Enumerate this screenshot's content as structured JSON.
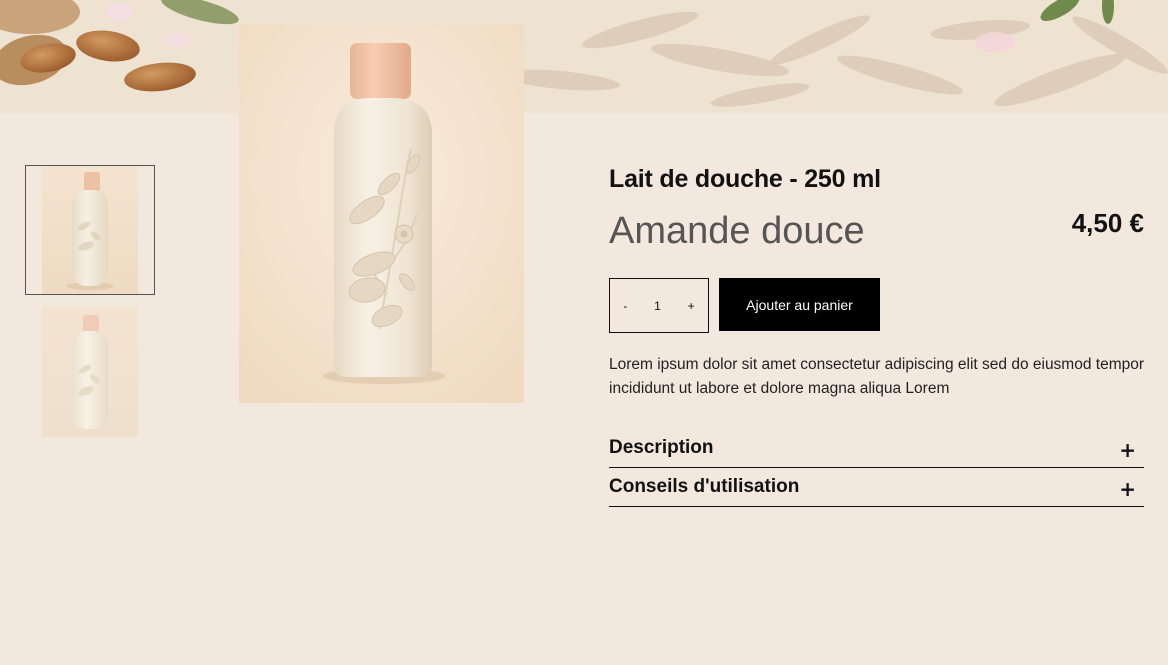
{
  "product": {
    "name": "Lait de douche - 250 ml",
    "variant": "Amande douce",
    "price": "4,50 €",
    "description": "Lorem ipsum dolor sit amet consectetur adipiscing elit sed do eiusmod tempor incididunt ut labore et dolore magna aliqua Lorem"
  },
  "quantity": {
    "decrement_label": "-",
    "value": "1",
    "increment_label": "+"
  },
  "cart": {
    "add_label": "Ajouter au panier"
  },
  "accordion": {
    "items": [
      {
        "title": "Description",
        "icon": "+"
      },
      {
        "title": "Conseils d'utilisation",
        "icon": "+"
      }
    ]
  },
  "colors": {
    "page_background": "#f3e8de",
    "button_background": "#000000",
    "bottle_body": "#f1e8da",
    "bottle_cap": "#f0c2a6"
  },
  "images": {
    "hero": "almonds-banner",
    "main": "shower-milk-bottle",
    "thumbnails": [
      "shower-milk-bottle-front",
      "shower-milk-bottle-alt"
    ]
  }
}
